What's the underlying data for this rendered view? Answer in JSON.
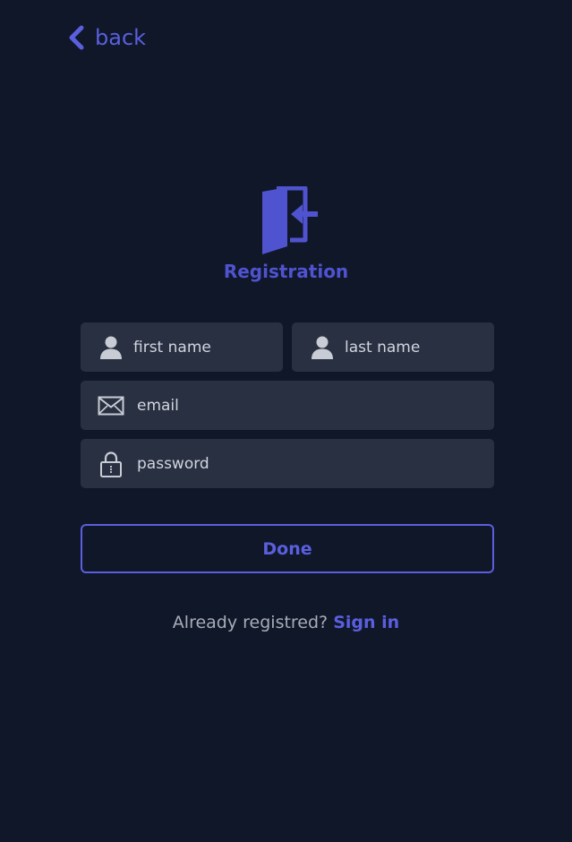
{
  "nav": {
    "back_label": "back",
    "back_icon": "chevron-left-icon"
  },
  "header": {
    "logo_icon": "door-enter-icon",
    "title": "Registration"
  },
  "form": {
    "first_name": {
      "placeholder": "first name",
      "value": "",
      "icon": "user-icon"
    },
    "last_name": {
      "placeholder": "last name",
      "value": "",
      "icon": "user-icon"
    },
    "email": {
      "placeholder": "email",
      "value": "",
      "icon": "envelope-icon"
    },
    "password": {
      "placeholder": "password",
      "value": "",
      "icon": "lock-icon"
    },
    "submit_label": "Done"
  },
  "footer": {
    "prompt": "Already registred?",
    "link_label": "Sign in"
  },
  "colors": {
    "background": "#0f1729",
    "field_background": "#293042",
    "accent": "#5b5fde",
    "title": "#5053cf",
    "muted_text": "#a8acb6"
  }
}
